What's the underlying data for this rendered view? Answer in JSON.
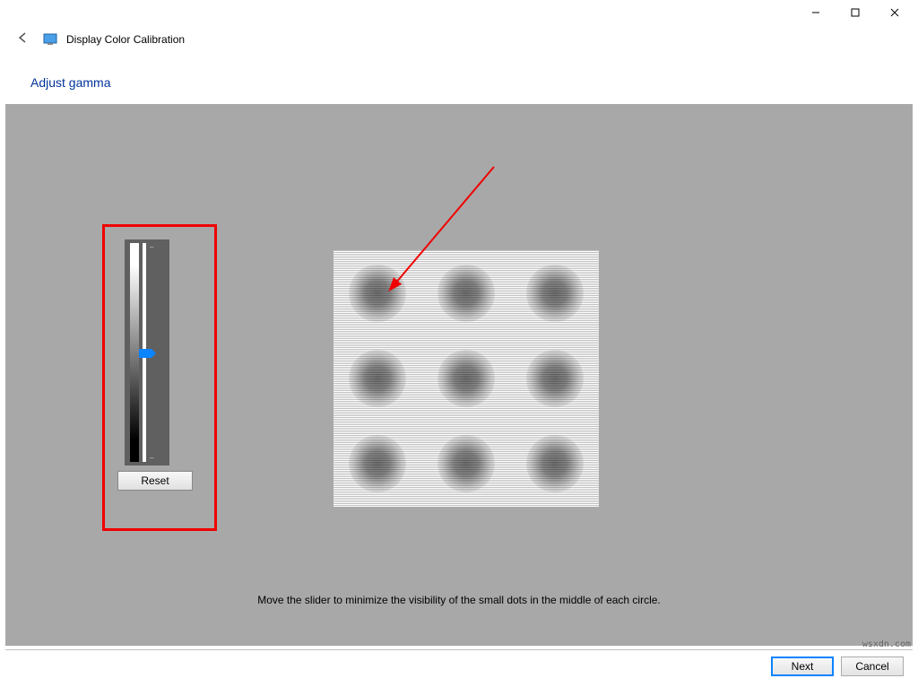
{
  "window": {
    "title": "Display Color Calibration"
  },
  "page": {
    "heading": "Adjust gamma",
    "instruction": "Move the slider to minimize the visibility of the small dots in the middle of each circle."
  },
  "slider": {
    "reset_label": "Reset"
  },
  "footer": {
    "next_label": "Next",
    "cancel_label": "Cancel"
  },
  "watermark": "wsxdn.com"
}
